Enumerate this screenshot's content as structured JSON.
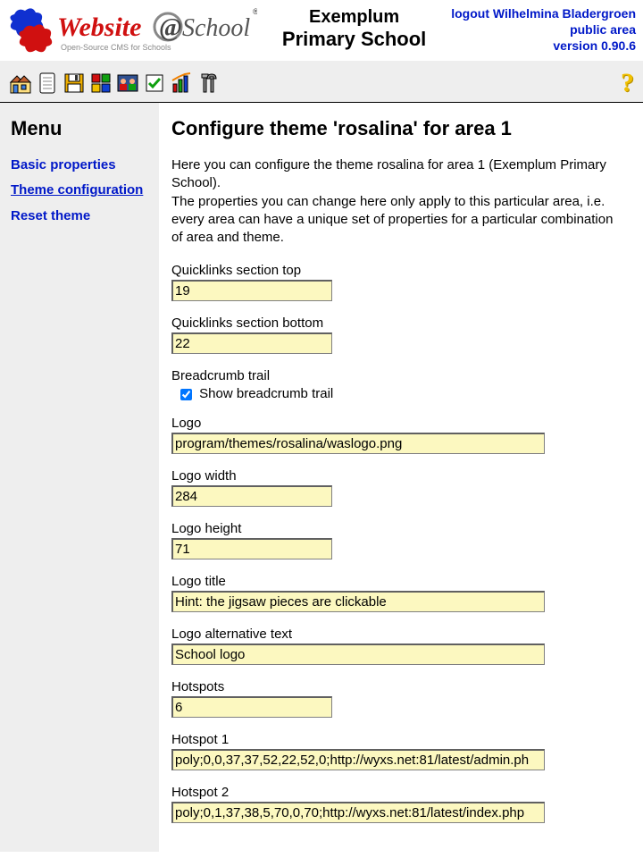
{
  "header": {
    "title_line1": "Exemplum",
    "title_line2": "Primary School",
    "links": {
      "logout": "logout Wilhelmina Bladergroen",
      "public_area": "public area",
      "version": "version 0.90.6"
    }
  },
  "sidebar": {
    "title": "Menu",
    "items": [
      {
        "label": "Basic properties",
        "active": false
      },
      {
        "label": "Theme configuration",
        "active": true
      },
      {
        "label": "Reset theme",
        "active": false
      }
    ]
  },
  "content": {
    "heading": "Configure theme 'rosalina' for area 1",
    "intro_p1": "Here you can configure the theme rosalina for area 1 (Exemplum Primary School).",
    "intro_p2": "The properties you can change here only apply to this particular area, i.e. every area can have a unique set of properties for a particular combination of area and theme."
  },
  "form": {
    "quicklinks_top": {
      "label": "Quicklinks section top",
      "value": "19"
    },
    "quicklinks_bottom": {
      "label": "Quicklinks section bottom",
      "value": "22"
    },
    "breadcrumb": {
      "label": "Breadcrumb trail",
      "checkbox_label": "Show breadcrumb trail",
      "checked": true
    },
    "logo": {
      "label": "Logo",
      "value": "program/themes/rosalina/waslogo.png"
    },
    "logo_width": {
      "label": "Logo width",
      "value": "284"
    },
    "logo_height": {
      "label": "Logo height",
      "value": "71"
    },
    "logo_title": {
      "label": "Logo title",
      "value": "Hint: the jigsaw pieces are clickable"
    },
    "logo_alt": {
      "label": "Logo alternative text",
      "value": "School logo"
    },
    "hotspots": {
      "label": "Hotspots",
      "value": "6"
    },
    "hotspot1": {
      "label": "Hotspot 1",
      "value": "poly;0,0,37,37,52,22,52,0;http://wyxs.net:81/latest/admin.ph"
    },
    "hotspot2": {
      "label": "Hotspot 2",
      "value": "poly;0,1,37,38,5,70,0,70;http://wyxs.net:81/latest/index.php"
    }
  },
  "help": {
    "symbol": "?"
  }
}
